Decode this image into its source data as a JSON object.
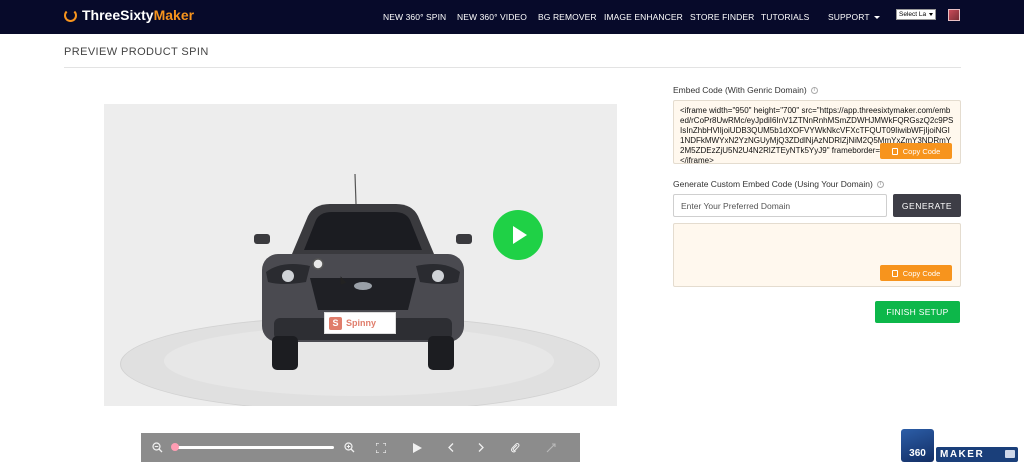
{
  "nav": {
    "logo_part1": "ThreeSixty",
    "logo_part2": "Maker",
    "links": [
      "NEW 360° SPIN",
      "NEW 360° VIDEO",
      "BG REMOVER",
      "IMAGE ENHANCER",
      "STORE FINDER",
      "TUTORIALS",
      "SUPPORT"
    ],
    "language_select": "Select La"
  },
  "page": {
    "title": "PREVIEW PRODUCT SPIN"
  },
  "preview": {
    "brand_badge": "Spinny",
    "brand_mark": "S"
  },
  "embed": {
    "label": "Embed Code (With Genric Domain)",
    "code": "<iframe width=\"950\" height=\"700\" src=\"https://app.threesixtymaker.com/embed/rCoPr8UwRMc/eyJpdiI6InV1ZTNnRnhMSmZDWHJMWkFQRGszQ2c9PSIsInZhbHVlIjoiUDB3QUM5b1dXOFVYWkNkcVFXcTFQUT09IiwibWFjIjoiNGI1NDFkMWYxN2YzNGUyMjQ3ZDdlNjAzNDRlZjNiM2Q5MmYxZmY3NDRmY2M5ZDEzZjU5N2U4N2RlZTEyNTk5YyJ9\" frameborder=\"0\" allowfullscreen></iframe>",
    "copy_label": "Copy Code"
  },
  "custom": {
    "label": "Generate Custom Embed Code (Using Your Domain)",
    "placeholder": "Enter Your Preferred Domain",
    "generate_label": "GENERATE",
    "copy_label": "Copy Code"
  },
  "actions": {
    "finish_label": "FINISH SETUP"
  },
  "badge": {
    "cube_text": "360",
    "label": "MAKER"
  },
  "colors": {
    "nav_bg": "#070a2a",
    "accent": "#f7941d",
    "play": "#1fd146",
    "finish": "#0db74a",
    "generate": "#3d3d46"
  }
}
